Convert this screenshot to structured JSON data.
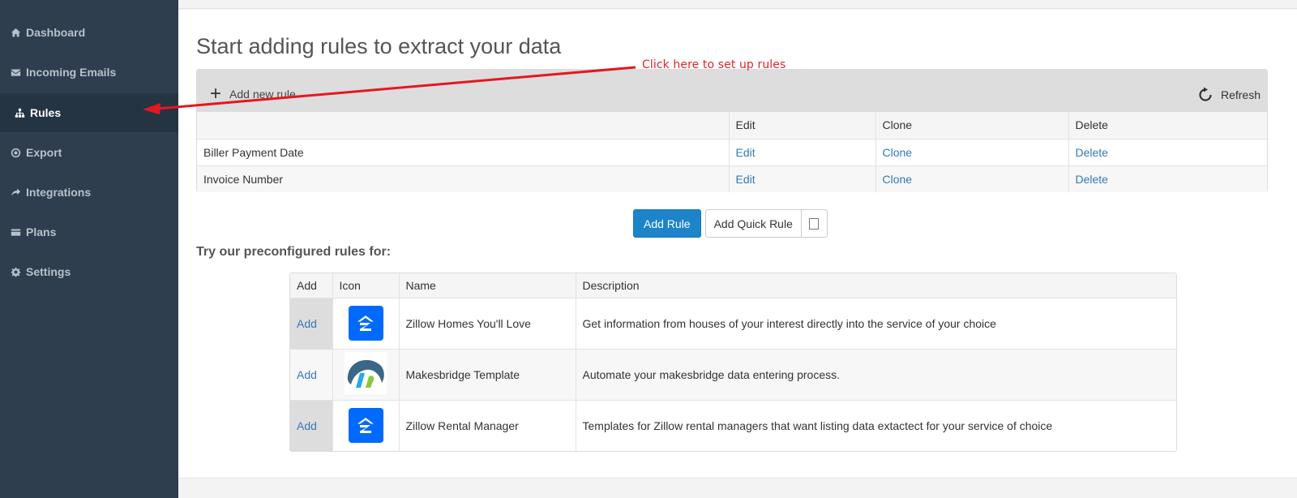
{
  "sidebar": {
    "items": [
      {
        "label": "Dashboard",
        "icon": "home-icon",
        "active": false
      },
      {
        "label": "Incoming Emails",
        "icon": "envelope-icon",
        "active": false
      },
      {
        "label": "Rules",
        "icon": "sitemap-icon",
        "active": true
      },
      {
        "label": "Export",
        "icon": "target-icon",
        "active": false
      },
      {
        "label": "Integrations",
        "icon": "share-arrow-icon",
        "active": false
      },
      {
        "label": "Plans",
        "icon": "credit-card-icon",
        "active": false
      },
      {
        "label": "Settings",
        "icon": "gear-icon",
        "active": false
      }
    ]
  },
  "main": {
    "title": "Start adding rules to extract your data",
    "rules_panel": {
      "add_new_rule_label": "Add new rule",
      "refresh_label": "Refresh",
      "columns": [
        "",
        "Edit",
        "Clone",
        "Delete"
      ],
      "rows": [
        {
          "name": "Biller Payment Date",
          "edit": "Edit",
          "clone": "Clone",
          "delete": "Delete"
        },
        {
          "name": "Invoice Number",
          "edit": "Edit",
          "clone": "Clone",
          "delete": "Delete"
        }
      ]
    },
    "buttons": {
      "add_rule": "Add Rule",
      "add_quick_rule": "Add Quick Rule",
      "quick_rule_checked": false
    },
    "preconfigured": {
      "heading": "Try our preconfigured rules for:",
      "columns": [
        "Add",
        "Icon",
        "Name",
        "Description"
      ],
      "rows": [
        {
          "add": "Add",
          "icon": "zillow-logo-icon",
          "name": "Zillow Homes You'll Love",
          "description": "Get information from houses of your interest directly into the service of your choice"
        },
        {
          "add": "Add",
          "icon": "makesbridge-logo-icon",
          "name": "Makesbridge Template",
          "description": "Automate your makesbridge data entering process."
        },
        {
          "add": "Add",
          "icon": "zillow-logo-icon",
          "name": "Zillow Rental Manager",
          "description": "Templates for Zillow rental managers that want listing data extactect for your service of choice"
        }
      ]
    }
  },
  "annotation": {
    "text": "Click here to set up rules",
    "color": "#e0242b"
  },
  "colors": {
    "sidebar_bg": "#2e3e4f",
    "sidebar_active_bg": "#253443",
    "primary_button": "#1d84c9",
    "link": "#337ab7",
    "zillow_blue": "#006aff"
  }
}
